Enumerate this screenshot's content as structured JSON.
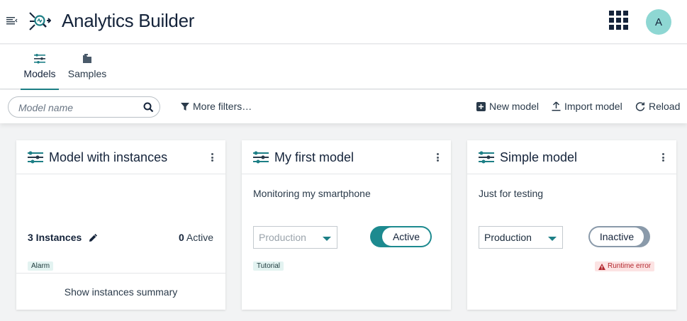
{
  "header": {
    "app_title": "Analytics Builder",
    "avatar_initial": "A",
    "accent_color": "#1d7f86",
    "avatar_color": "#8ed7d3"
  },
  "tabs": [
    {
      "label": "Models",
      "icon": "models-icon",
      "active": true
    },
    {
      "label": "Samples",
      "icon": "folder-icon",
      "active": false
    }
  ],
  "toolbar": {
    "search_placeholder": "Model name",
    "more_filters_label": "More filters…",
    "new_model_label": "New model",
    "import_model_label": "Import model",
    "reload_label": "Reload"
  },
  "cards": [
    {
      "title": "Model with instances",
      "instances_label": "3 Instances",
      "active_count": "0",
      "active_label": "Active",
      "tag": "Alarm",
      "footer_label": "Show instances summary"
    },
    {
      "title": "My first model",
      "description": "Monitoring my smartphone",
      "mode": "Production",
      "state_label": "Active",
      "tag": "Tutorial"
    },
    {
      "title": "Simple model",
      "description": "Just for testing",
      "mode": "Production",
      "state_label": "Inactive",
      "error_label": "Runtime error",
      "error_color": "#b3272d"
    }
  ]
}
